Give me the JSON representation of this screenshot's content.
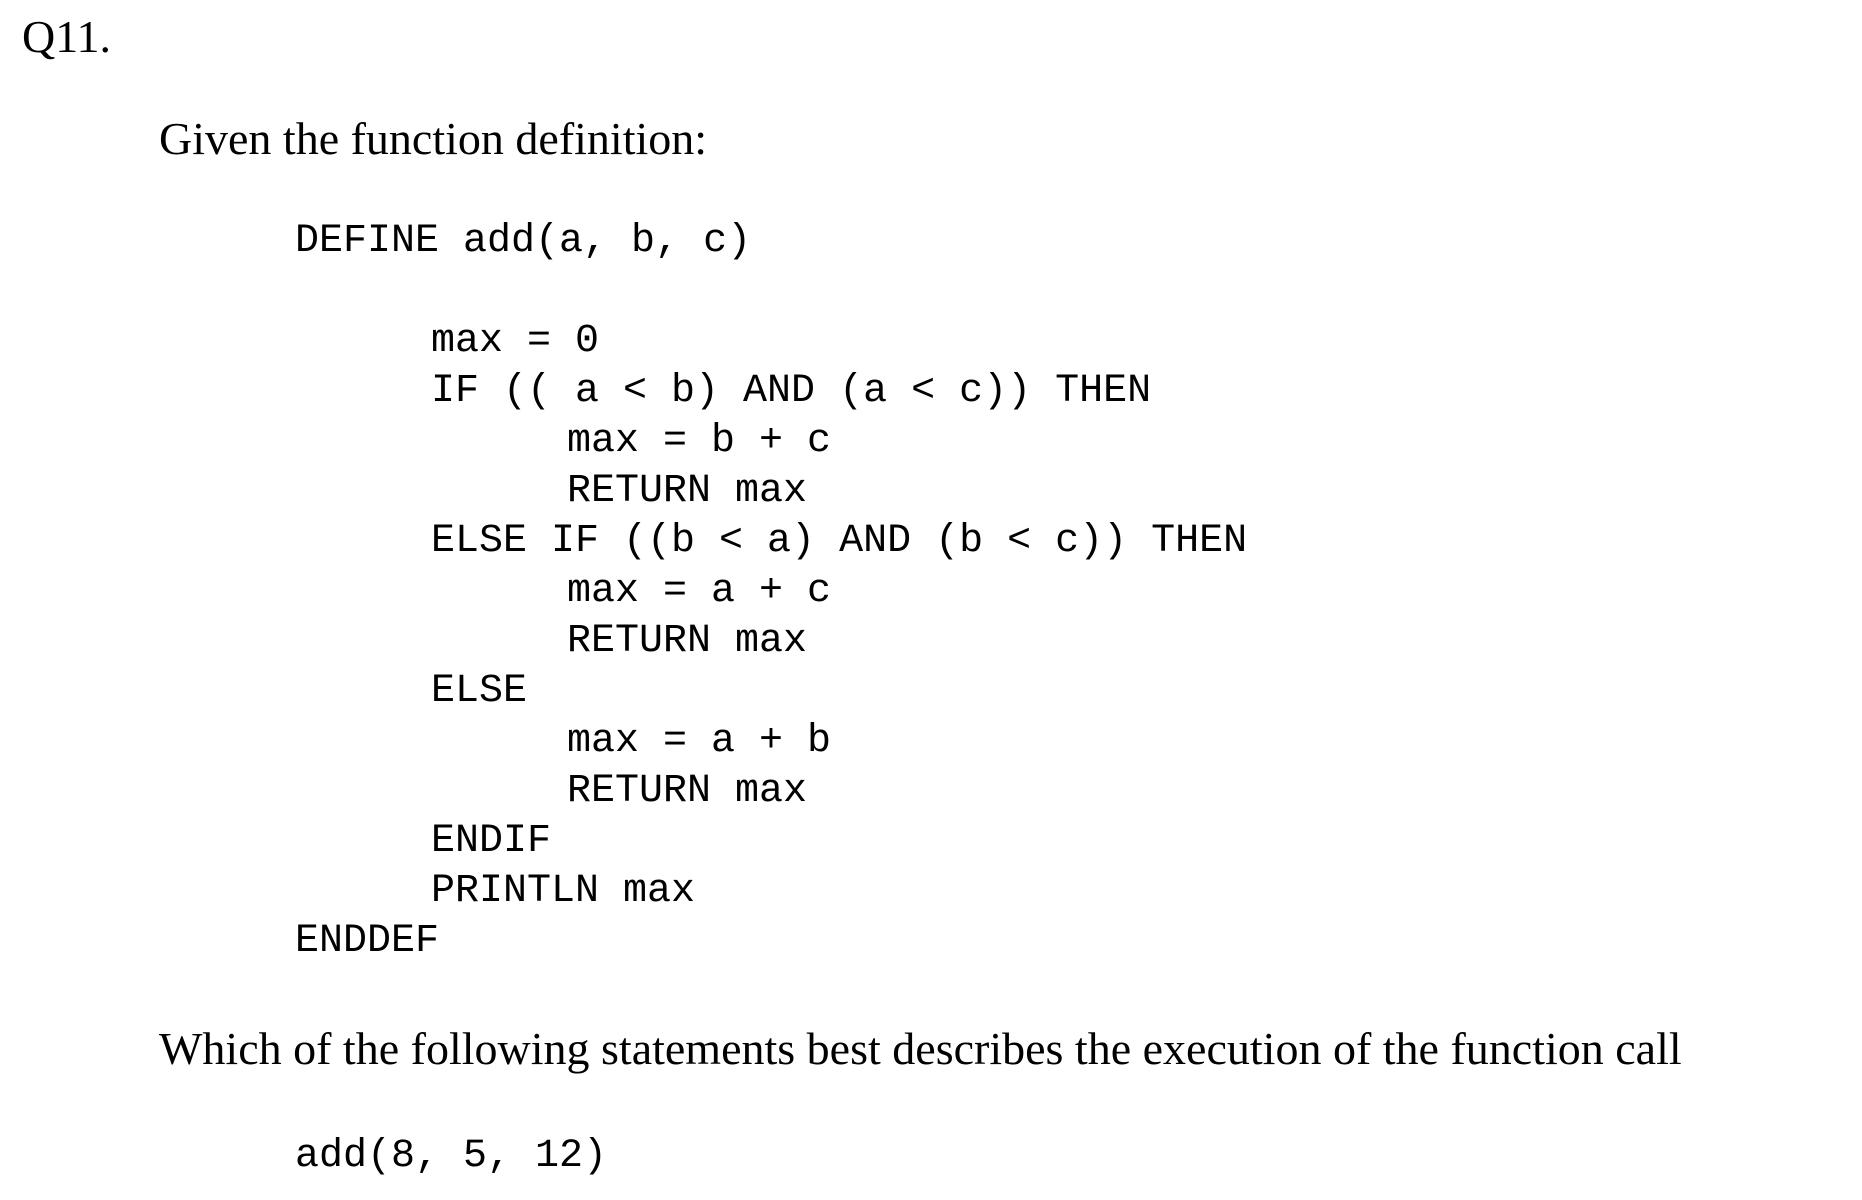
{
  "question_number": "Q11.",
  "intro_text": "Given the function definition:",
  "code_lines": [
    "DEFINE add(a, b, c)",
    "max = 0",
    "IF (( a < b) AND (a < c)) THEN",
    "max = b + c",
    "RETURN max",
    "ELSE IF ((b < a) AND (b < c)) THEN",
    "max = a + c",
    "RETURN max",
    "ELSE",
    "max = a + b",
    "RETURN max",
    "ENDIF",
    "PRINTLN max",
    "ENDDEF"
  ],
  "question_text": "Which of the following statements best describes the execution of the function call",
  "call_expression": "add(8, 5, 12)"
}
